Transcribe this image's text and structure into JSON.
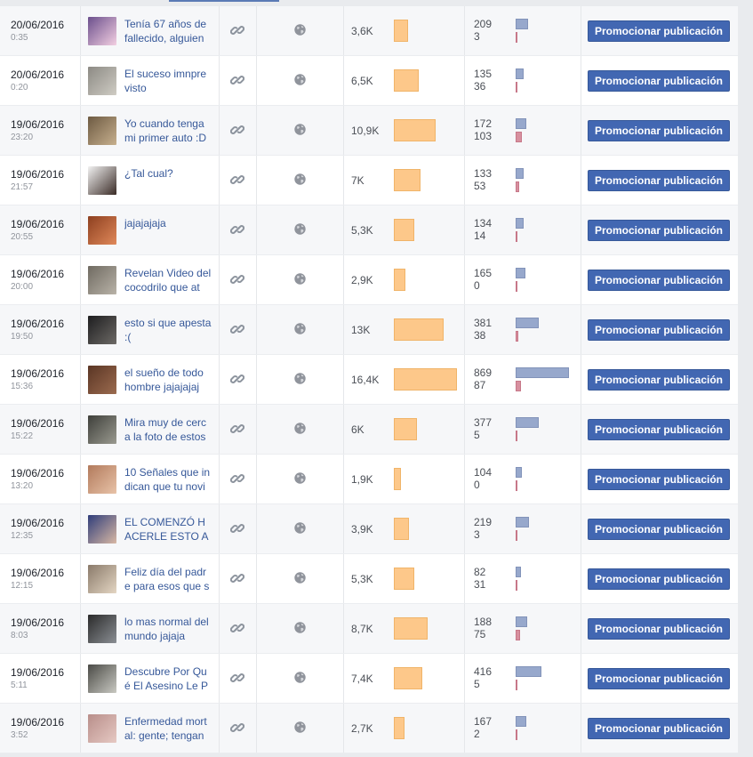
{
  "promote_label": "Promocionar publicación",
  "colors": {
    "reach": "#fdc88a",
    "engagement_primary": "#97a8cc",
    "engagement_secondary": "#d7909f",
    "button": "#4267b2",
    "link_text": "#365899"
  },
  "posts": [
    {
      "date": "20/06/2016",
      "time": "0:35",
      "title": "Tenía 67 años de fallecido, alguien",
      "reach": "3,6K",
      "reach_value": 3600,
      "eng_a": "209",
      "eng_b": "3",
      "thumb": [
        "#6b4f8c",
        "#f3cfe2"
      ]
    },
    {
      "date": "20/06/2016",
      "time": "0:20",
      "title": "El suceso imnpre visto",
      "reach": "6,5K",
      "reach_value": 6500,
      "eng_a": "135",
      "eng_b": "36",
      "thumb": [
        "#8c8a84",
        "#cfccc4"
      ]
    },
    {
      "date": "19/06/2016",
      "time": "23:20",
      "title": "Yo cuando tenga mi primer auto :D",
      "reach": "10,9K",
      "reach_value": 10900,
      "eng_a": "172",
      "eng_b": "103",
      "thumb": [
        "#6d5a42",
        "#c7b08e"
      ]
    },
    {
      "date": "19/06/2016",
      "time": "21:57",
      "title": "¿Tal cual?",
      "reach": "7K",
      "reach_value": 7000,
      "eng_a": "133",
      "eng_b": "53",
      "thumb": [
        "#f2f2f2",
        "#3a2b26"
      ]
    },
    {
      "date": "19/06/2016",
      "time": "20:55",
      "title": "jajajajaja",
      "reach": "5,3K",
      "reach_value": 5300,
      "eng_a": "134",
      "eng_b": "14",
      "thumb": [
        "#8d3f1f",
        "#e0895a"
      ]
    },
    {
      "date": "19/06/2016",
      "time": "20:00",
      "title": "Revelan Video del cocodrilo que at",
      "reach": "2,9K",
      "reach_value": 2900,
      "eng_a": "165",
      "eng_b": "0",
      "thumb": [
        "#6f6a61",
        "#b9b3a8"
      ]
    },
    {
      "date": "19/06/2016",
      "time": "19:50",
      "title": "esto si que apesta :(",
      "reach": "13K",
      "reach_value": 13000,
      "eng_a": "381",
      "eng_b": "38",
      "thumb": [
        "#1d1d1f",
        "#6d6a66"
      ]
    },
    {
      "date": "19/06/2016",
      "time": "15:36",
      "title": "el sueño de todo hombre jajajajaj",
      "reach": "16,4K",
      "reach_value": 16400,
      "eng_a": "869",
      "eng_b": "87",
      "thumb": [
        "#5a3524",
        "#9b6b4f"
      ]
    },
    {
      "date": "19/06/2016",
      "time": "15:22",
      "title": "Mira muy de cerca la foto de estos",
      "reach": "6K",
      "reach_value": 6000,
      "eng_a": "377",
      "eng_b": "5",
      "thumb": [
        "#3e3f3a",
        "#9a9a90"
      ]
    },
    {
      "date": "19/06/2016",
      "time": "13:20",
      "title": "10 Señales que indican que tu novi",
      "reach": "1,9K",
      "reach_value": 1900,
      "eng_a": "104",
      "eng_b": "0",
      "thumb": [
        "#b27a5c",
        "#e8c3a8"
      ]
    },
    {
      "date": "19/06/2016",
      "time": "12:35",
      "title": "EL COMENZÓ HACERLE ESTO A S",
      "reach": "3,9K",
      "reach_value": 3900,
      "eng_a": "219",
      "eng_b": "3",
      "thumb": [
        "#2f3d7a",
        "#d8b8a4"
      ]
    },
    {
      "date": "19/06/2016",
      "time": "12:15",
      "title": "Feliz día del padre para esos que s",
      "reach": "5,3K",
      "reach_value": 5300,
      "eng_a": "82",
      "eng_b": "31",
      "thumb": [
        "#8a7a6a",
        "#e4d6c3"
      ]
    },
    {
      "date": "19/06/2016",
      "time": "8:03",
      "title": "lo mas normal del mundo jajaja",
      "reach": "8,7K",
      "reach_value": 8700,
      "eng_a": "188",
      "eng_b": "75",
      "thumb": [
        "#2a2a2a",
        "#8b8f94"
      ]
    },
    {
      "date": "19/06/2016",
      "time": "5:11",
      "title": "Descubre Por Qué El Asesino Le P",
      "reach": "7,4K",
      "reach_value": 7400,
      "eng_a": "416",
      "eng_b": "5",
      "thumb": [
        "#4a4a46",
        "#c9c9c2"
      ]
    },
    {
      "date": "19/06/2016",
      "time": "3:52",
      "title": "Enfermedad mortal: gente; tengan",
      "reach": "2,7K",
      "reach_value": 2700,
      "eng_a": "167",
      "eng_b": "2",
      "thumb": [
        "#b88e8a",
        "#e6c9c3"
      ]
    }
  ]
}
